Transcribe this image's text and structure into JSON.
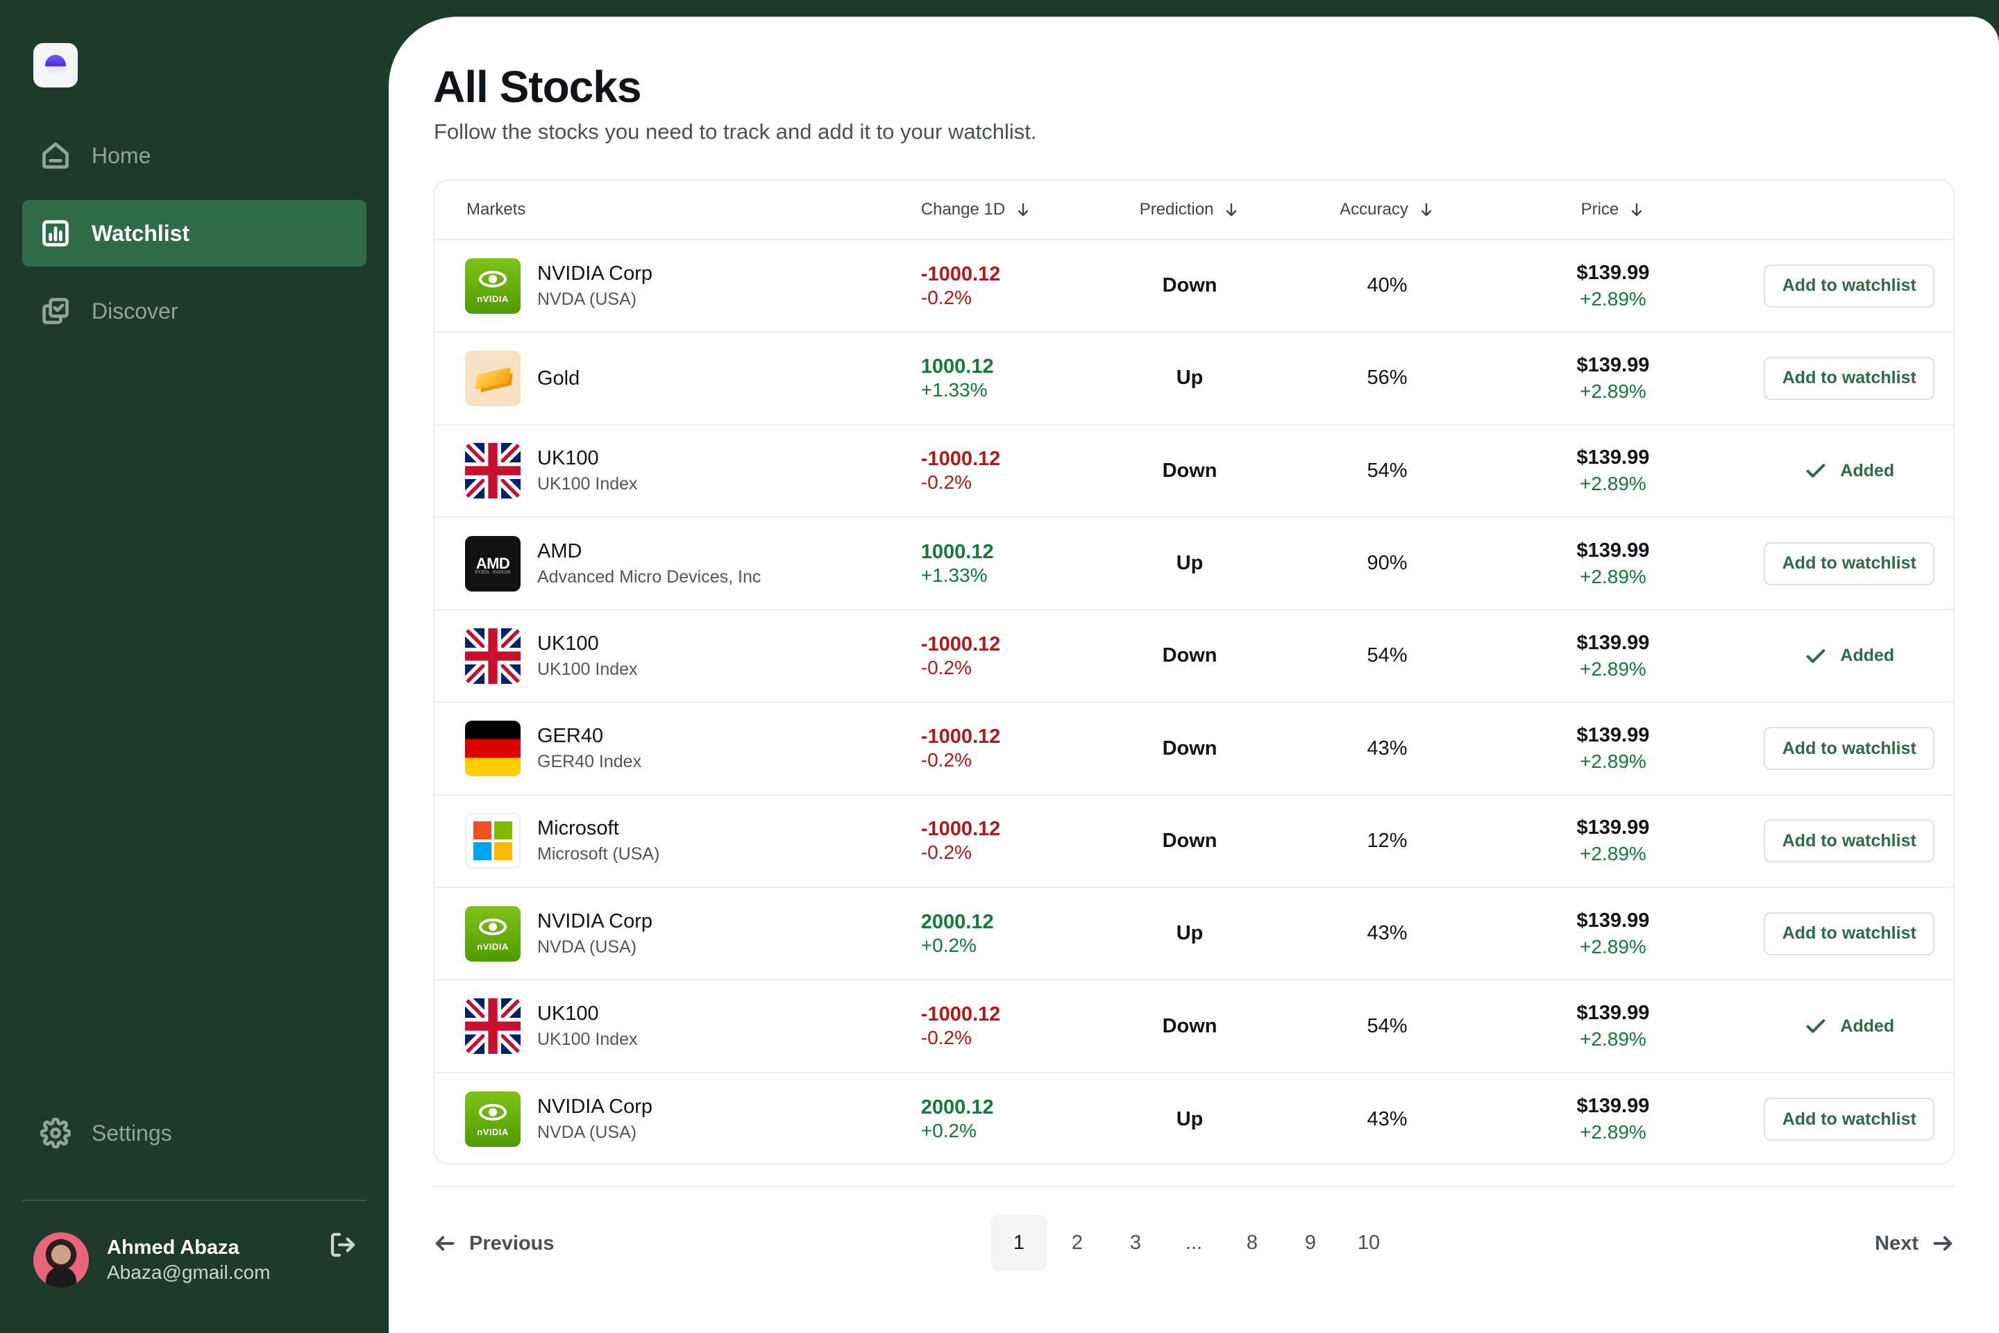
{
  "sidebar": {
    "nav": [
      {
        "label": "Home",
        "icon": "home-icon"
      },
      {
        "label": "Watchlist",
        "icon": "chart-icon"
      },
      {
        "label": "Discover",
        "icon": "discover-icon"
      }
    ],
    "settings_label": "Settings",
    "user": {
      "name": "Ahmed Abaza",
      "email": "Abaza@gmail.com"
    }
  },
  "main": {
    "title": "All Stocks",
    "subtitle": "Follow the stocks you need to track and add it to your watchlist."
  },
  "table": {
    "headers": {
      "markets": "Markets",
      "change": "Change 1D",
      "prediction": "Prediction",
      "accuracy": "Accuracy",
      "price": "Price"
    },
    "rows": [
      {
        "logo": "nvidia",
        "name": "NVIDIA Corp",
        "sub": "NVDA (USA)",
        "change": "-1000.12",
        "change_pct": "-0.2%",
        "dir": "neg",
        "prediction": "Down",
        "accuracy": "40%",
        "price": "$139.99",
        "price_pct": "+2.89%",
        "action": "Add to watchlist",
        "added": false
      },
      {
        "logo": "gold",
        "name": "Gold",
        "sub": "",
        "change": "1000.12",
        "change_pct": "+1.33%",
        "dir": "pos",
        "prediction": "Up",
        "accuracy": "56%",
        "price": "$139.99",
        "price_pct": "+2.89%",
        "action": "Add to watchlist",
        "added": false
      },
      {
        "logo": "uk",
        "name": "UK100",
        "sub": "UK100 Index",
        "change": "-1000.12",
        "change_pct": "-0.2%",
        "dir": "neg",
        "prediction": "Down",
        "accuracy": "54%",
        "price": "$139.99",
        "price_pct": "+2.89%",
        "action": "Added",
        "added": true
      },
      {
        "logo": "amd",
        "name": "AMD",
        "sub": "Advanced Micro Devices, Inc",
        "change": "1000.12",
        "change_pct": "+1.33%",
        "dir": "pos",
        "prediction": "Up",
        "accuracy": "90%",
        "price": "$139.99",
        "price_pct": "+2.89%",
        "action": "Add to watchlist",
        "added": false
      },
      {
        "logo": "uk",
        "name": "UK100",
        "sub": "UK100 Index",
        "change": "-1000.12",
        "change_pct": "-0.2%",
        "dir": "neg",
        "prediction": "Down",
        "accuracy": "54%",
        "price": "$139.99",
        "price_pct": "+2.89%",
        "action": "Added",
        "added": true
      },
      {
        "logo": "de",
        "name": "GER40",
        "sub": "GER40 Index",
        "change": "-1000.12",
        "change_pct": "-0.2%",
        "dir": "neg",
        "prediction": "Down",
        "accuracy": "43%",
        "price": "$139.99",
        "price_pct": "+2.89%",
        "action": "Add to watchlist",
        "added": false
      },
      {
        "logo": "ms",
        "name": "Microsoft",
        "sub": "Microsoft (USA)",
        "change": "-1000.12",
        "change_pct": "-0.2%",
        "dir": "neg",
        "prediction": "Down",
        "accuracy": "12%",
        "price": "$139.99",
        "price_pct": "+2.89%",
        "action": "Add to watchlist",
        "added": false
      },
      {
        "logo": "nvidia",
        "name": "NVIDIA Corp",
        "sub": "NVDA (USA)",
        "change": "2000.12",
        "change_pct": "+0.2%",
        "dir": "pos",
        "prediction": "Up",
        "accuracy": "43%",
        "price": "$139.99",
        "price_pct": "+2.89%",
        "action": "Add to watchlist",
        "added": false
      },
      {
        "logo": "uk",
        "name": "UK100",
        "sub": "UK100 Index",
        "change": "-1000.12",
        "change_pct": "-0.2%",
        "dir": "neg",
        "prediction": "Down",
        "accuracy": "54%",
        "price": "$139.99",
        "price_pct": "+2.89%",
        "action": "Added",
        "added": true
      },
      {
        "logo": "nvidia",
        "name": "NVIDIA Corp",
        "sub": "NVDA (USA)",
        "change": "2000.12",
        "change_pct": "+0.2%",
        "dir": "pos",
        "prediction": "Up",
        "accuracy": "43%",
        "price": "$139.99",
        "price_pct": "+2.89%",
        "action": "Add to watchlist",
        "added": false
      }
    ]
  },
  "logo_text": {
    "nvidia": "nVIDIA",
    "amd": "AMD",
    "amd_sub": "RYZEN · RADEON"
  },
  "pagination": {
    "previous": "Previous",
    "next": "Next",
    "pages": [
      "1",
      "2",
      "3",
      "...",
      "8",
      "9",
      "10"
    ],
    "current": "1"
  },
  "colors": {
    "sidebar_bg": "#1e3a2b",
    "accent": "#2f6b48",
    "negative": "#b3191b",
    "positive": "#127a3b"
  }
}
